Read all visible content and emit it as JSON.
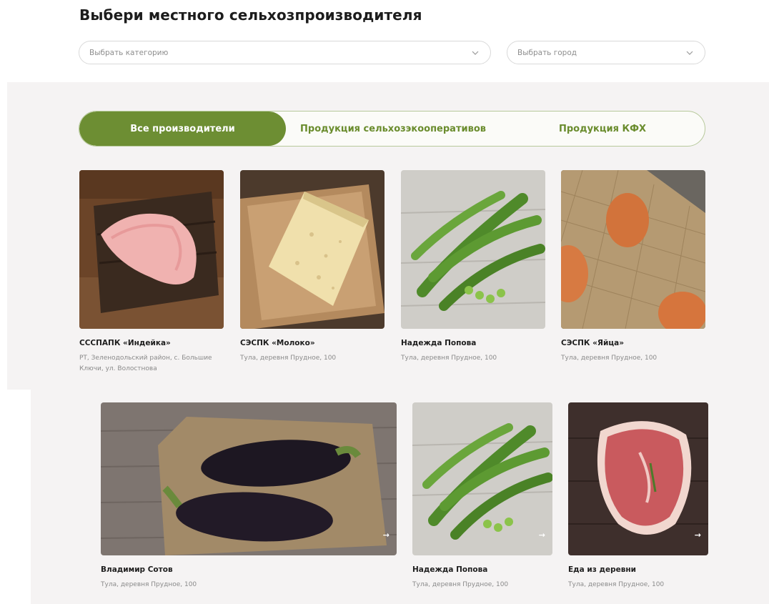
{
  "page": {
    "title": "Выбери местного сельхозпроизводителя"
  },
  "filters": {
    "category_placeholder": "Выбрать категорию",
    "city_placeholder": "Выбрать город"
  },
  "tabs": [
    {
      "label": "Все производители",
      "active": true
    },
    {
      "label": "Продукция сельхозэкооперативов",
      "active": false
    },
    {
      "label": "Продукция КФХ",
      "active": false
    }
  ],
  "producers": [
    {
      "name": "СССПАПК «Индейка»",
      "address": "РТ, Зеленодольский район, с. Большие Ключи, ул. Волостнова",
      "image": "turkey-meat"
    },
    {
      "name": "СЭСПК «Молоко»",
      "address": "Тула, деревня Прудное, 100",
      "image": "cheese"
    },
    {
      "name": "Надежда Попова",
      "address": "Тула, деревня Прудное, 100",
      "image": "green-peas"
    },
    {
      "name": "СЭСПК «Яйца»",
      "address": "Тула, деревня Прудное, 100",
      "image": "eggs"
    },
    {
      "name": "Владимир Сотов",
      "address": "Тула, деревня Прудное, 100",
      "image": "eggplants"
    },
    {
      "name": "Надежда Попова",
      "address": "Тула, деревня Прудное, 100",
      "image": "green-peas"
    },
    {
      "name": "Еда из деревни",
      "address": "Тула, деревня Прудное, 100",
      "image": "ham"
    }
  ],
  "arrow_glyph": "→",
  "colors": {
    "accent": "#6d8e33",
    "panel_bg": "#f5f3f3",
    "text": "#1d1d1d",
    "muted": "#8a8a8a"
  }
}
